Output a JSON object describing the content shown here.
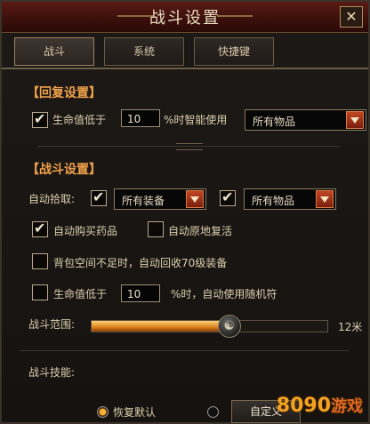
{
  "window": {
    "title": "战斗设置",
    "close_glyph": "✕"
  },
  "tabs": [
    {
      "label": "战斗",
      "active": true
    },
    {
      "label": "系统",
      "active": false
    },
    {
      "label": "快捷键",
      "active": false
    }
  ],
  "recover": {
    "heading": "【回复设置】",
    "hp_label": "生命值低于",
    "hp_value": "10",
    "hp_suffix": "%时智能使用",
    "item_select": "所有物品",
    "hp_checked": true
  },
  "battle": {
    "heading": "【战斗设置】",
    "pickup_label": "自动拾取:",
    "pickup1_checked": true,
    "pickup1_select": "所有装备",
    "pickup2_checked": true,
    "pickup2_select": "所有物品",
    "auto_buy": {
      "label": "自动购买药品",
      "checked": true
    },
    "auto_revive": {
      "label": "自动原地复活",
      "checked": false
    },
    "auto_recycle": {
      "label": "背包空间不足时，自动回收70级装备",
      "checked": false
    },
    "random": {
      "label": "生命值低于",
      "value": "10",
      "suffix": "%时，自动使用随机符",
      "checked": false
    },
    "range_label": "战斗范围:",
    "range_value_text": "12米",
    "range_fraction": 0.58
  },
  "skills": {
    "label": "战斗技能:",
    "restore_default": "恢复默认",
    "custom_button": "自定义",
    "restore_selected": true
  },
  "watermark": {
    "brand": "8090",
    "sub": "游戏"
  },
  "colors": {
    "accent": "#f0a14a",
    "slider_fill": "#d8801c",
    "dropdown_arrow": "#c24622"
  }
}
